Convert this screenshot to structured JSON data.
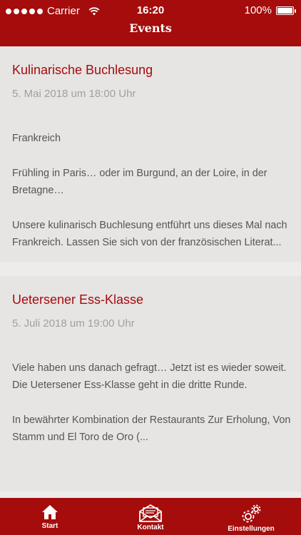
{
  "status_bar": {
    "carrier": "Carrier",
    "time": "16:20",
    "battery": "100%"
  },
  "nav": {
    "title": "Events"
  },
  "events": [
    {
      "title": "Kulinarische Buchlesung",
      "date": "5. Mai 2018 um 18:00 Uhr",
      "paragraphs": [
        "Frankreich",
        "Frühling in Paris… oder im Burgund, an der Loire, in der Bretagne…",
        "Unsere kulinarisch Buchlesung entführt uns dieses Mal nach Frankreich. Lassen Sie sich von der französischen Literat..."
      ]
    },
    {
      "title": "Uetersener Ess-Klasse",
      "date": "5. Juli 2018 um 19:00 Uhr",
      "paragraphs": [
        "Viele haben uns danach gefragt… Jetzt ist es wieder soweit. Die Uetersener Ess-Klasse geht in die dritte Runde.",
        "In bewährter Kombination der Restaurants Zur Erholung, Von Stamm und El Toro de Oro (..."
      ]
    }
  ],
  "tabs": [
    {
      "label": "Start",
      "icon": "home-icon"
    },
    {
      "label": "Kontakt",
      "icon": "mail-icon"
    },
    {
      "label": "Einstellungen",
      "icon": "gears-icon"
    }
  ],
  "colors": {
    "brand": "#a50c0c",
    "card": "#e7e4e4",
    "background": "#eeebeb"
  }
}
